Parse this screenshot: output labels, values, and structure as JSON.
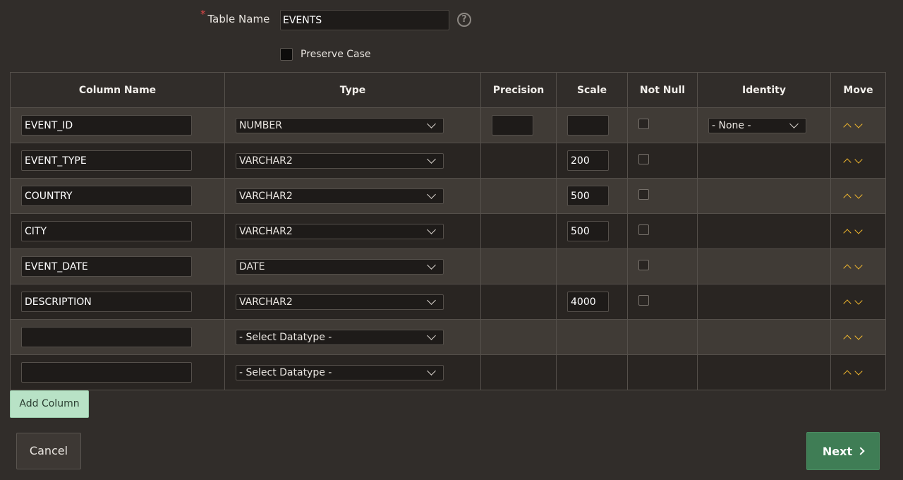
{
  "table_name": {
    "label": "Table Name",
    "required_marker": "*",
    "value": "EVENTS",
    "help": "?"
  },
  "preserve_case": {
    "label": "Preserve Case",
    "checked": false
  },
  "headers": {
    "column_name": "Column Name",
    "type": "Type",
    "precision": "Precision",
    "scale": "Scale",
    "not_null": "Not Null",
    "identity": "Identity",
    "move": "Move"
  },
  "rows": [
    {
      "name": "EVENT_ID",
      "type": "NUMBER",
      "precision": "",
      "scale": "",
      "not_null": false,
      "identity": "- None -"
    },
    {
      "name": "EVENT_TYPE",
      "type": "VARCHAR2",
      "scale": "200",
      "not_null": false
    },
    {
      "name": "COUNTRY",
      "type": "VARCHAR2",
      "scale": "500",
      "not_null": false
    },
    {
      "name": "CITY",
      "type": "VARCHAR2",
      "scale": "500",
      "not_null": false
    },
    {
      "name": "EVENT_DATE",
      "type": "DATE",
      "not_null": false
    },
    {
      "name": "DESCRIPTION",
      "type": "VARCHAR2",
      "scale": "4000",
      "not_null": false
    },
    {
      "name": "",
      "type": "- Select Datatype -"
    },
    {
      "name": "",
      "type": "- Select Datatype -"
    }
  ],
  "buttons": {
    "add_column": "Add Column",
    "cancel": "Cancel",
    "next": "Next"
  },
  "colors": {
    "background": "#312d2a",
    "accent_arrow": "#f2b82e",
    "next_button": "#3f7d55",
    "add_column_button": "#b8e2c6"
  }
}
